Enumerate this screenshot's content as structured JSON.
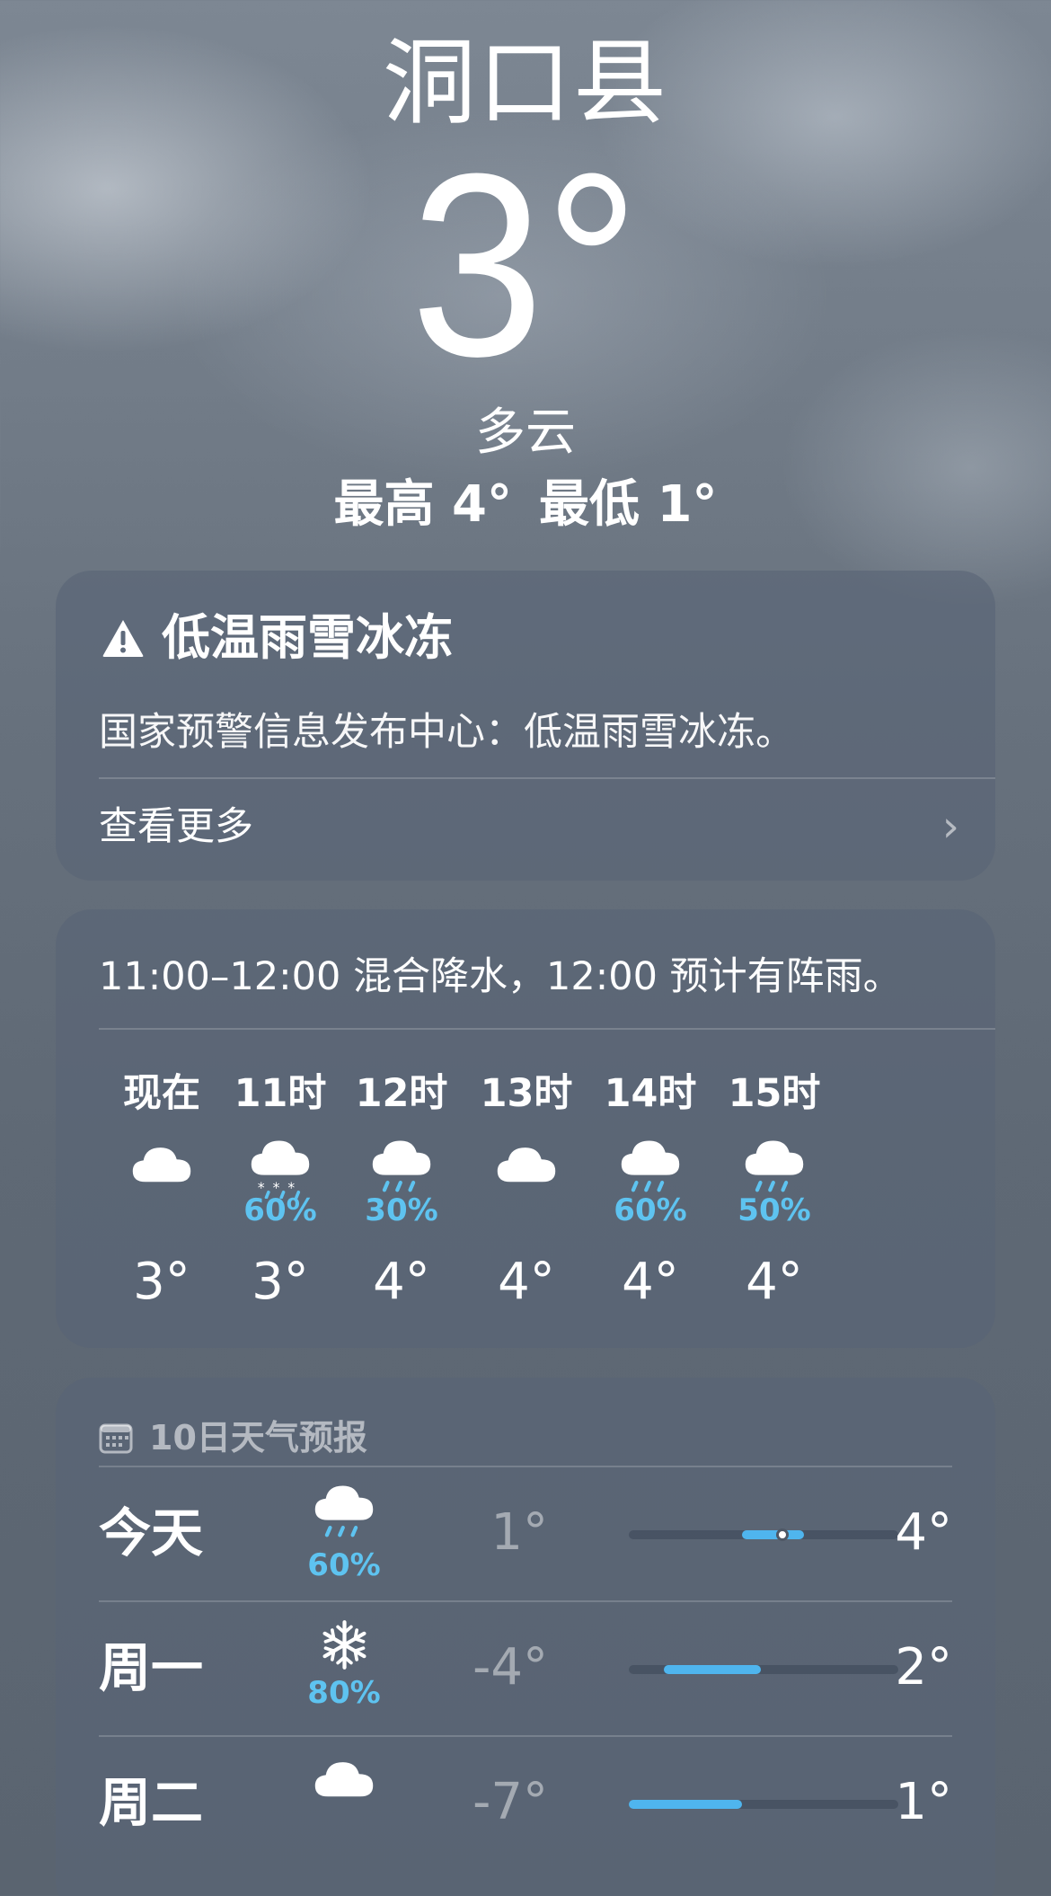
{
  "location": {
    "city": "洞口县",
    "temperature": "3°",
    "condition": "多云",
    "high": "最高 4°",
    "low": "最低 1°"
  },
  "alert": {
    "title": "低温雨雪冰冻",
    "body": "国家预警信息发布中心：低温雨雪冰冻。",
    "more_label": "查看更多",
    "icon": "warning-triangle-icon"
  },
  "hourly": {
    "summary": "11:00–12:00 混合降水，12:00 预计有阵雨。",
    "items": [
      {
        "label": "现在",
        "icon": "cloud-icon",
        "precip": "",
        "temp": "3°"
      },
      {
        "label": "11时",
        "icon": "cloud-snow-icon",
        "precip": "60%",
        "temp": "3°"
      },
      {
        "label": "12时",
        "icon": "cloud-rain-icon",
        "precip": "30%",
        "temp": "4°"
      },
      {
        "label": "13时",
        "icon": "cloud-icon",
        "precip": "",
        "temp": "4°"
      },
      {
        "label": "14时",
        "icon": "cloud-rain-icon",
        "precip": "60%",
        "temp": "4°"
      },
      {
        "label": "15时",
        "icon": "cloud-rain-icon",
        "precip": "50%",
        "temp": "4°"
      }
    ]
  },
  "daily": {
    "header": "10日天气预报",
    "days": [
      {
        "name": "今天",
        "icon": "cloud-rain-icon",
        "precip": "60%",
        "low": "1°",
        "high": "4°",
        "range_start": 0.42,
        "range_end": 0.65,
        "current": 0.57
      },
      {
        "name": "周一",
        "icon": "snowflake-icon",
        "precip": "80%",
        "low": "-4°",
        "high": "2°",
        "range_start": 0.13,
        "range_end": 0.49
      },
      {
        "name": "周二",
        "icon": "cloud-icon",
        "precip": "",
        "low": "-7°",
        "high": "1°",
        "range_start": 0.0,
        "range_end": 0.42
      }
    ]
  },
  "colors": {
    "precip_blue": "#5ec3f0",
    "bar_blue": "#4fb5ee"
  }
}
